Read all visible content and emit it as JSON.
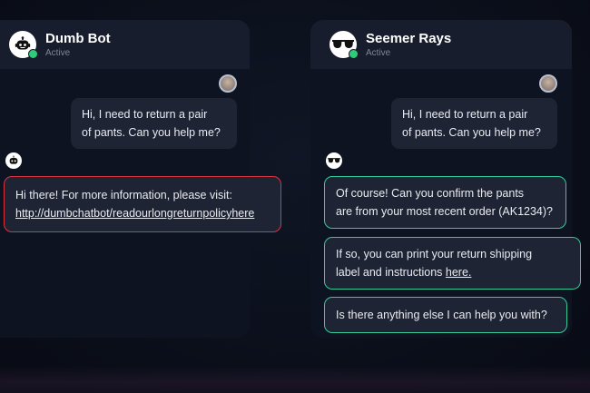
{
  "dumb_bot": {
    "name": "Dumb Bot",
    "status": "Active",
    "user_message_line1": "Hi, I need to return a pair",
    "user_message_line2": "of pants. Can you help me?",
    "reply_text": "Hi there! For more information, please visit:",
    "reply_link": "http://dumbchatbot/readourlongreturnpolicyhere",
    "avatar_icon": "robot-icon",
    "highlight_color": "#d9353f"
  },
  "seemer_rays": {
    "name": "Seemer Rays",
    "status": "Active",
    "user_message_line1": "Hi, I need to return a pair",
    "user_message_line2": "of pants. Can you help me?",
    "reply1_line1": "Of course!  Can you confirm the pants",
    "reply1_line2": "are from your most recent order (AK1234)?",
    "reply2_line1": "If so, you can print your return shipping",
    "reply2_line2_prefix": "label and instructions ",
    "reply2_link": "here.",
    "reply3": "Is there anything else I can help you with?",
    "avatar_icon": "sunglasses-icon",
    "highlight_color": "#36c99a"
  },
  "status_color": "#2ecc7a"
}
